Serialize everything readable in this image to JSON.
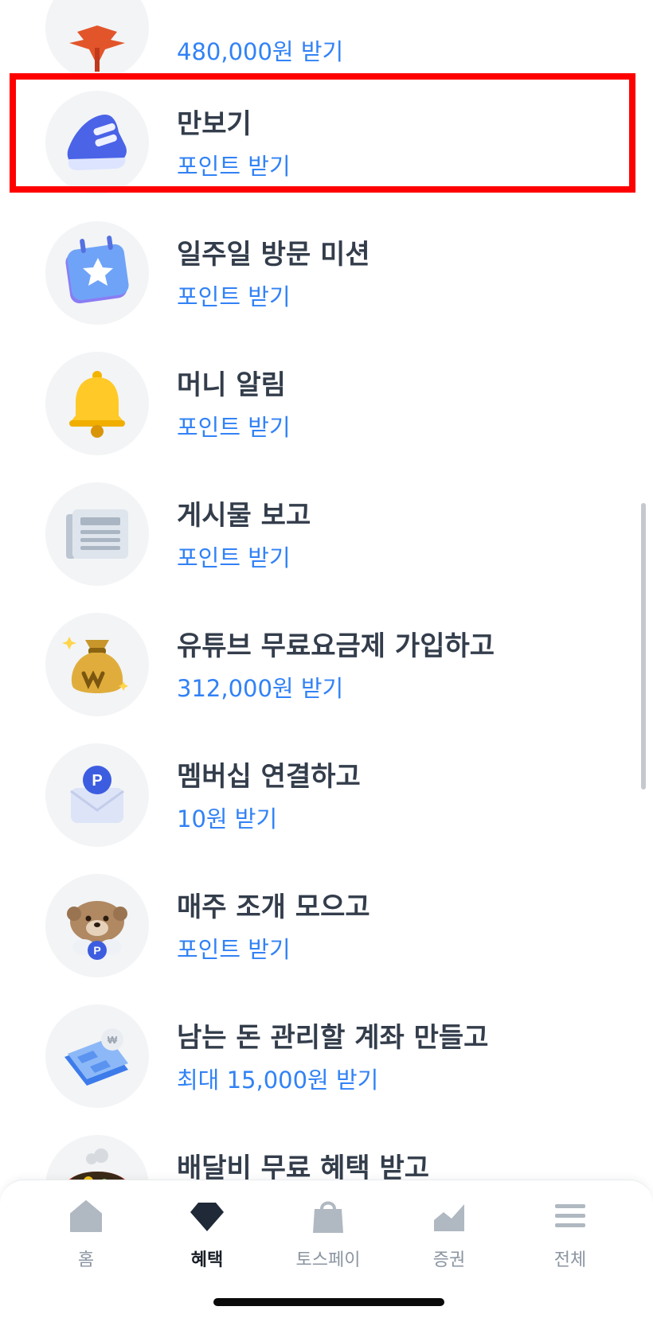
{
  "list": [
    {
      "title": "",
      "subtitle": "480,000원 받기",
      "icon": "maple-leaf-icon"
    },
    {
      "title": "만보기",
      "subtitle": "포인트 받기",
      "icon": "sneaker-icon"
    },
    {
      "title": "일주일 방문 미션",
      "subtitle": "포인트 받기",
      "icon": "star-calendar-icon"
    },
    {
      "title": "머니 알림",
      "subtitle": "포인트 받기",
      "icon": "bell-icon"
    },
    {
      "title": "게시물 보고",
      "subtitle": "포인트 받기",
      "icon": "newspaper-icon"
    },
    {
      "title": "유튜브 무료요금제 가입하고",
      "subtitle": "312,000원 받기",
      "icon": "money-bag-icon"
    },
    {
      "title": "멤버십 연결하고",
      "subtitle": "10원 받기",
      "icon": "envelope-point-icon"
    },
    {
      "title": "매주 조개 모으고",
      "subtitle": "포인트 받기",
      "icon": "otter-icon"
    },
    {
      "title": "남는 돈 관리할 계좌 만들고",
      "subtitle": "최대 15,000원 받기",
      "icon": "bankbook-icon"
    },
    {
      "title": "배달비 무료 혜택 받고",
      "subtitle": "",
      "icon": "food-bowl-icon"
    }
  ],
  "tabs": [
    {
      "label": "홈",
      "icon": "home-icon",
      "active": false
    },
    {
      "label": "혜택",
      "icon": "diamond-icon",
      "active": true
    },
    {
      "label": "토스페이",
      "icon": "shopping-bag-icon",
      "active": false
    },
    {
      "label": "증권",
      "icon": "stock-chart-icon",
      "active": false
    },
    {
      "label": "전체",
      "icon": "menu-icon",
      "active": false
    }
  ],
  "colors": {
    "accent_blue": "#3182f6",
    "highlight_red": "#ff0000",
    "title_text": "#333d4b",
    "tab_inactive": "#8b95a1",
    "tab_active": "#191f28"
  }
}
